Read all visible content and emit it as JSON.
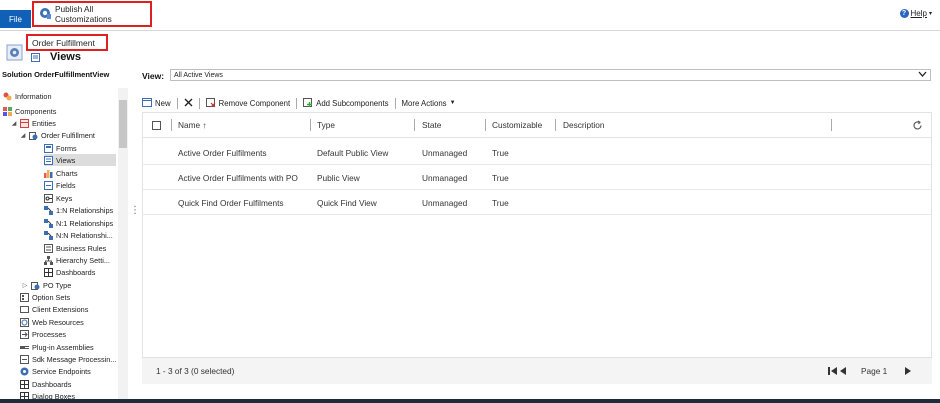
{
  "topbar": {
    "file_label": "File",
    "publish_label": "Publish All Customizations",
    "help_label": "Help"
  },
  "header": {
    "entity_name": "Order Fulfillment",
    "page_title": "Views",
    "solution_label": "Solution OrderFulfillmentView"
  },
  "sidebar": {
    "items": [
      {
        "label": "Information",
        "icon": "information-icon"
      },
      {
        "label": "Components",
        "icon": "components-icon"
      },
      {
        "label": "Entities",
        "icon": "entities-icon"
      },
      {
        "label": "Order Fulfillment",
        "icon": "entity-icon"
      },
      {
        "label": "Forms",
        "icon": "forms-icon"
      },
      {
        "label": "Views",
        "icon": "views-icon"
      },
      {
        "label": "Charts",
        "icon": "charts-icon"
      },
      {
        "label": "Fields",
        "icon": "fields-icon"
      },
      {
        "label": "Keys",
        "icon": "keys-icon"
      },
      {
        "label": "1:N Relationships",
        "icon": "relationship-icon"
      },
      {
        "label": "N:1 Relationships",
        "icon": "relationship-icon"
      },
      {
        "label": "N:N Relationshi...",
        "icon": "relationship-icon"
      },
      {
        "label": "Business Rules",
        "icon": "business-rules-icon"
      },
      {
        "label": "Hierarchy Setti...",
        "icon": "hierarchy-icon"
      },
      {
        "label": "Dashboards",
        "icon": "dashboards-icon"
      },
      {
        "label": "PO Type",
        "icon": "entity-icon"
      },
      {
        "label": "Option Sets",
        "icon": "option-sets-icon"
      },
      {
        "label": "Client Extensions",
        "icon": "client-extensions-icon"
      },
      {
        "label": "Web Resources",
        "icon": "web-resources-icon"
      },
      {
        "label": "Processes",
        "icon": "processes-icon"
      },
      {
        "label": "Plug-in Assemblies",
        "icon": "plugin-icon"
      },
      {
        "label": "Sdk Message Processin...",
        "icon": "sdk-icon"
      },
      {
        "label": "Service Endpoints",
        "icon": "service-endpoints-icon"
      },
      {
        "label": "Dashboards",
        "icon": "dashboards-icon"
      },
      {
        "label": "Dialog Boxes",
        "icon": "dialog-icon"
      }
    ]
  },
  "view": {
    "label": "View:",
    "selected": "All Active Views"
  },
  "toolbar": {
    "new_label": "New",
    "remove_label": "Remove Component",
    "add_label": "Add Subcomponents",
    "more_label": "More Actions"
  },
  "grid": {
    "columns": [
      "Name ↑",
      "Type",
      "State",
      "Customizable",
      "Description"
    ],
    "rows": [
      {
        "name": "Active Order Fulfilments",
        "type": "Default Public View",
        "state": "Unmanaged",
        "customizable": "True"
      },
      {
        "name": "Active Order Fulfilments with PO",
        "type": "Public View",
        "state": "Unmanaged",
        "customizable": "True"
      },
      {
        "name": "Quick Find Order Fulfilments",
        "type": "Quick Find View",
        "state": "Unmanaged",
        "customizable": "True"
      }
    ],
    "footer_count": "1 - 3 of 3 (0 selected)",
    "page_label": "Page 1"
  },
  "colors": {
    "accent": "#1160b7",
    "highlight_border": "#e02020",
    "selected_bg": "#dcdcdc"
  }
}
